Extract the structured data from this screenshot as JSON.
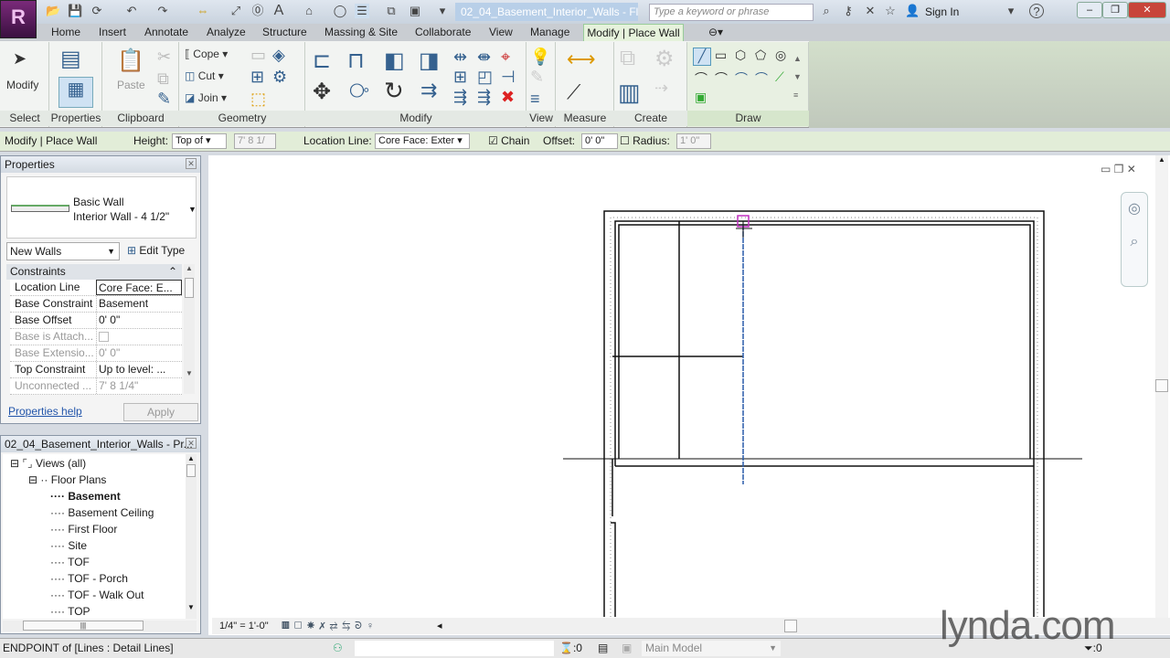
{
  "app": {
    "logo_letter": "R",
    "title": "02_04_Basement_Interior_Walls - Fl...",
    "search_placeholder": "Type a keyword or phrase",
    "sign_in": "Sign In"
  },
  "tabs": [
    "Home",
    "Insert",
    "Annotate",
    "Analyze",
    "Structure",
    "Massing & Site",
    "Collaborate",
    "View",
    "Manage",
    "Modify | Place Wall"
  ],
  "ribbon": {
    "modify": "Modify",
    "paste": "Paste",
    "cope": "Cope",
    "cut": "Cut",
    "join": "Join",
    "panels": [
      "Select",
      "Properties",
      "Clipboard",
      "Geometry",
      "Modify",
      "View",
      "Measure",
      "Create",
      "Draw"
    ]
  },
  "options": {
    "context": "Modify | Place Wall",
    "height_label": "Height:",
    "height_value": "Top of",
    "height_dim": "7' 8 1/",
    "location_label": "Location Line:",
    "location_value": "Core Face: Exter",
    "chain_label": "Chain",
    "chain_checked": true,
    "offset_label": "Offset:",
    "offset_value": "0'  0\"",
    "radius_label": "Radius:",
    "radius_checked": false,
    "radius_value": "1'  0\""
  },
  "properties": {
    "title": "Properties",
    "family": "Basic Wall",
    "type": "Interior Wall - 4 1/2\"",
    "instance_filter": "New Walls",
    "edit_type": "Edit Type",
    "group": "Constraints",
    "rows": [
      {
        "k": "Location Line",
        "v": "Core Face: E..."
      },
      {
        "k": "Base Constraint",
        "v": "Basement"
      },
      {
        "k": "Base Offset",
        "v": "0'  0\""
      },
      {
        "k": "Base is Attach...",
        "v": ""
      },
      {
        "k": "Base Extensio...",
        "v": "0'  0\""
      },
      {
        "k": "Top Constraint",
        "v": "Up to level: ..."
      },
      {
        "k": "Unconnected ...",
        "v": "7'  8 1/4\""
      }
    ],
    "help": "Properties help",
    "apply": "Apply"
  },
  "browser": {
    "title": "02_04_Basement_Interior_Walls - Pr...",
    "root": "Views (all)",
    "group": "Floor Plans",
    "items": [
      "Basement",
      "Basement Ceiling",
      "First Floor",
      "Site",
      "TOF",
      "TOF - Porch",
      "TOF - Walk Out",
      "TOP"
    ],
    "active": "Basement"
  },
  "view": {
    "scale": "1/4\" = 1'-0\""
  },
  "status": {
    "text": "ENDPOINT  of [Lines : Detail Lines]",
    "worksets": ":0",
    "model": "Main Model",
    "filter": ":0"
  },
  "watermark": "lynda.com"
}
